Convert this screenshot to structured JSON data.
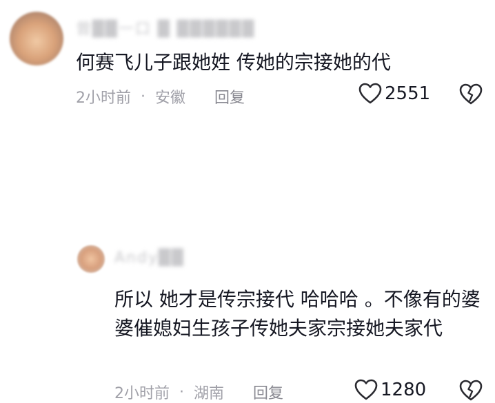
{
  "comments": [
    {
      "username": "曾██一口 █ ██████",
      "text": "何赛飞儿子跟她姓 传她的宗接她的代",
      "time": "2小时前",
      "separator": "·",
      "location": "安徽",
      "reply_label": "回复",
      "likes": "2551",
      "avatar_icon": "user-avatar-blurred"
    },
    {
      "username": "Andy██",
      "text": "所以  她才是传宗接代  哈哈哈  。不像有的婆婆催媳妇生孩子传她夫家宗接她夫家代",
      "time": "2小时前",
      "separator": "·",
      "location": "湖南",
      "reply_label": "回复",
      "likes": "1280",
      "avatar_icon": "user-avatar-blurred"
    }
  ],
  "icons": {
    "like": "heart-outline-icon",
    "dislike": "broken-heart-icon"
  },
  "colors": {
    "text": "#161823",
    "meta": "#a0a0a8",
    "background": "#ffffff"
  }
}
